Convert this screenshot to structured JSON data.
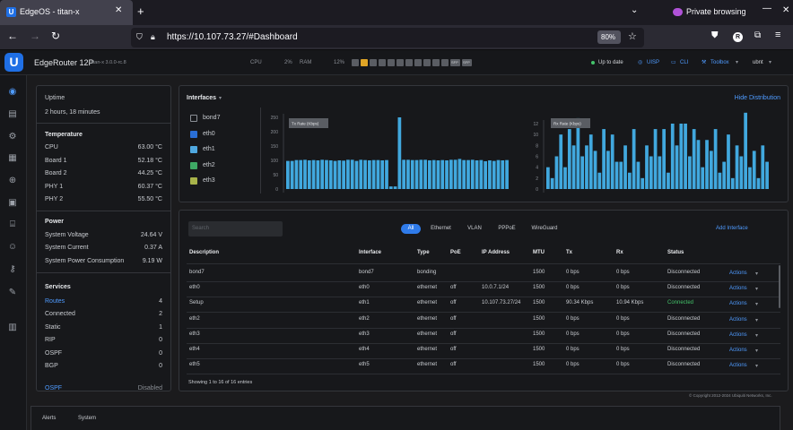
{
  "browser": {
    "tab_title": "EdgeOS - titan-x",
    "private_label": "Private browsing",
    "url": "https://10.107.73.27/#Dashboard",
    "zoom": "80%"
  },
  "topbar": {
    "device_name": "EdgeRouter 12P",
    "device_sub": "titan-x 3.0.0-rc.8",
    "cpu_label": "CPU",
    "cpu_value": "2%",
    "ram_label": "RAM",
    "ram_value": "12%",
    "port_sfp1": "SFP",
    "port_sfp2": "SFP",
    "status": "Up to date",
    "uisp": "UISP",
    "cli": "CLI",
    "toolbox": "Toolbox",
    "user": "ubnt",
    "colors": {
      "accent": "#4f9bff",
      "ok": "#44c36a",
      "port_active": "#e0a526"
    }
  },
  "sidebar_icons": [
    "dashboard-icon",
    "stats-icon",
    "routing-icon",
    "firewall-icon",
    "vpn-icon",
    "services-icon",
    "users-icon",
    "wizards-icon",
    "config-icon",
    "qos-icon",
    "misc-icon"
  ],
  "left": {
    "uptime_label": "Uptime",
    "uptime_value": "2 hours, 18 minutes",
    "temperature_title": "Temperature",
    "temps": [
      {
        "label": "CPU",
        "value": "63.00 °C"
      },
      {
        "label": "Board 1",
        "value": "52.18 °C"
      },
      {
        "label": "Board 2",
        "value": "44.25 °C"
      },
      {
        "label": "PHY 1",
        "value": "60.37 °C"
      },
      {
        "label": "PHY 2",
        "value": "55.50 °C"
      }
    ],
    "power_title": "Power",
    "power": [
      {
        "label": "System Voltage",
        "value": "24.64 V"
      },
      {
        "label": "System Current",
        "value": "0.37 A"
      },
      {
        "label": "System Power Consumption",
        "value": "9.19 W"
      }
    ],
    "services_title": "Services",
    "services": [
      {
        "label": "Routes",
        "value": "4"
      },
      {
        "label": "Connected",
        "value": "2"
      },
      {
        "label": "Static",
        "value": "1"
      },
      {
        "label": "RIP",
        "value": "0"
      },
      {
        "label": "OSPF",
        "value": "0"
      },
      {
        "label": "BGP",
        "value": "0"
      }
    ],
    "ospf_label": "OSPF",
    "ospf_value": "Disabled"
  },
  "interfaces_panel": {
    "title": "Interfaces",
    "hide_link": "Hide Distribution",
    "legend": [
      {
        "name": "bond7",
        "color": "#17181b"
      },
      {
        "name": "eth0",
        "color": "#2a6fd6"
      },
      {
        "name": "eth1",
        "color": "#4fa8e0"
      },
      {
        "name": "eth2",
        "color": "#3ea865"
      },
      {
        "name": "eth3",
        "color": "#a8b34a"
      }
    ]
  },
  "chart_data": [
    {
      "type": "bar",
      "title": "Tx Rate (Kbps)",
      "ylim": [
        0,
        250
      ],
      "yticks": [
        "250",
        "200",
        "150",
        "100",
        "50",
        "0"
      ],
      "color": "#41a8de",
      "values": [
        98,
        98,
        101,
        101,
        102,
        100,
        101,
        100,
        102,
        101,
        100,
        98,
        100,
        99,
        102,
        102,
        98,
        102,
        101,
        100,
        101,
        101,
        100,
        101,
        9,
        9,
        250,
        102,
        102,
        101,
        101,
        102,
        102,
        100,
        101,
        100,
        101,
        100,
        102,
        102,
        105,
        101,
        101,
        102,
        100,
        101,
        97,
        100,
        98,
        101,
        100,
        101
      ]
    },
    {
      "type": "bar",
      "title": "Rx Rate (Kbps)",
      "ylim": [
        0,
        12
      ],
      "yticks": [
        "12",
        "10",
        "8",
        "6",
        "4",
        "2",
        "0"
      ],
      "color": "#41a8de",
      "values": [
        4,
        2,
        6,
        10,
        4,
        11,
        8,
        13,
        6,
        8,
        10,
        7,
        3,
        11,
        7,
        10,
        5,
        5,
        8,
        3,
        11,
        5,
        2,
        8,
        6,
        11,
        6,
        11,
        3,
        12,
        8,
        12,
        12,
        6,
        11,
        9,
        4,
        9,
        7,
        11,
        3,
        5,
        10,
        2,
        8,
        6,
        14,
        4,
        7,
        2,
        8,
        5
      ]
    }
  ],
  "table_panel": {
    "search_placeholder": "Search",
    "filters": [
      "All",
      "Ethernet",
      "VLAN",
      "PPPoE",
      "WireGuard"
    ],
    "add_link": "Add Interface",
    "columns": [
      "Description",
      "Interface",
      "Type",
      "PoE",
      "IP Address",
      "MTU",
      "Tx",
      "Rx",
      "Status"
    ],
    "rows": [
      {
        "desc": "bond7",
        "iface": "bond7",
        "type": "bonding",
        "poe": "",
        "ip": "",
        "mtu": "1500",
        "tx": "0 bps",
        "rx": "0 bps",
        "status": "Disconnected",
        "actions": "Actions"
      },
      {
        "desc": "eth0",
        "iface": "eth0",
        "type": "ethernet",
        "poe": "off",
        "ip": "10.0.7.1/24",
        "mtu": "1500",
        "tx": "0 bps",
        "rx": "0 bps",
        "status": "Disconnected",
        "actions": "Actions"
      },
      {
        "desc": "Setup",
        "iface": "eth1",
        "type": "ethernet",
        "poe": "off",
        "ip": "10.107.73.27/24",
        "mtu": "1500",
        "tx": "90.34 Kbps",
        "rx": "10.94 Kbps",
        "status": "Connected",
        "actions": "Actions"
      },
      {
        "desc": "eth2",
        "iface": "eth2",
        "type": "ethernet",
        "poe": "off",
        "ip": "",
        "mtu": "1500",
        "tx": "0 bps",
        "rx": "0 bps",
        "status": "Disconnected",
        "actions": "Actions"
      },
      {
        "desc": "eth3",
        "iface": "eth3",
        "type": "ethernet",
        "poe": "off",
        "ip": "",
        "mtu": "1500",
        "tx": "0 bps",
        "rx": "0 bps",
        "status": "Disconnected",
        "actions": "Actions"
      },
      {
        "desc": "eth4",
        "iface": "eth4",
        "type": "ethernet",
        "poe": "off",
        "ip": "",
        "mtu": "1500",
        "tx": "0 bps",
        "rx": "0 bps",
        "status": "Disconnected",
        "actions": "Actions"
      },
      {
        "desc": "eth5",
        "iface": "eth5",
        "type": "ethernet",
        "poe": "off",
        "ip": "",
        "mtu": "1500",
        "tx": "0 bps",
        "rx": "0 bps",
        "status": "Disconnected",
        "actions": "Actions"
      }
    ],
    "footer": "Showing 1 to 16 of 16 entries"
  },
  "copyright": "© Copyright 2012-2024 Ubiquiti Networks, Inc.",
  "bottom_tabs": [
    "Alerts",
    "System"
  ]
}
